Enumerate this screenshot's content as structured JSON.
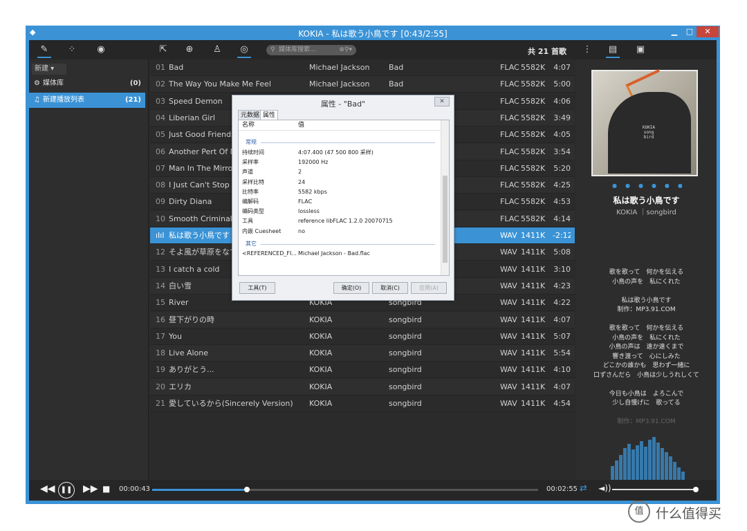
{
  "window": {
    "title": "KOKIA - 私は歌う小鳥です [0:43/2:55]",
    "minimize": "▁",
    "maximize": "□",
    "close": "✕"
  },
  "search": {
    "placeholder": "媒体库搜索..."
  },
  "count_label": "共 21 首歌",
  "sidebar": {
    "new_label": "新建 ▾",
    "items": [
      {
        "icon": "gear-icon",
        "label": "媒体库",
        "count": "(0)"
      },
      {
        "icon": "music-note-icon",
        "label": "新建播放列表",
        "count": "(21)"
      }
    ]
  },
  "tracks": [
    {
      "n": "01",
      "title": "Bad",
      "artist": "Michael Jackson",
      "album": "Bad",
      "fmt": "FLAC",
      "bitrate": "5582K",
      "dur": "4:07"
    },
    {
      "n": "02",
      "title": "The Way You Make Me Feel",
      "artist": "Michael Jackson",
      "album": "Bad",
      "fmt": "FLAC",
      "bitrate": "5582K",
      "dur": "5:00"
    },
    {
      "n": "03",
      "title": "Speed Demon",
      "artist": "",
      "album": "",
      "fmt": "FLAC",
      "bitrate": "5582K",
      "dur": "4:06"
    },
    {
      "n": "04",
      "title": "Liberian Girl",
      "artist": "",
      "album": "",
      "fmt": "FLAC",
      "bitrate": "5582K",
      "dur": "3:49"
    },
    {
      "n": "05",
      "title": "Just Good Friends",
      "artist": "",
      "album": "",
      "fmt": "FLAC",
      "bitrate": "5582K",
      "dur": "4:05"
    },
    {
      "n": "06",
      "title": "Another Pert Of Me",
      "artist": "",
      "album": "",
      "fmt": "FLAC",
      "bitrate": "5582K",
      "dur": "3:54"
    },
    {
      "n": "07",
      "title": "Man In The Mirror",
      "artist": "",
      "album": "",
      "fmt": "FLAC",
      "bitrate": "5582K",
      "dur": "5:20"
    },
    {
      "n": "08",
      "title": "I Just Can't Stop Lo",
      "artist": "",
      "album": "",
      "fmt": "FLAC",
      "bitrate": "5582K",
      "dur": "4:25"
    },
    {
      "n": "09",
      "title": "Dirty Diana",
      "artist": "",
      "album": "",
      "fmt": "FLAC",
      "bitrate": "5582K",
      "dur": "4:53"
    },
    {
      "n": "10",
      "title": "Smooth Criminal",
      "artist": "",
      "album": "",
      "fmt": "FLAC",
      "bitrate": "5582K",
      "dur": "4:14"
    },
    {
      "n": "ıIıl",
      "title": "私は歌う小鳥です",
      "artist": "",
      "album": "",
      "fmt": "WAV",
      "bitrate": "1411K",
      "dur": "-2:12"
    },
    {
      "n": "12",
      "title": "そよ風が草原をなで",
      "artist": "",
      "album": "",
      "fmt": "WAV",
      "bitrate": "1411K",
      "dur": "5:08"
    },
    {
      "n": "13",
      "title": "I catch a cold",
      "artist": "",
      "album": "",
      "fmt": "WAV",
      "bitrate": "1411K",
      "dur": "3:10"
    },
    {
      "n": "14",
      "title": "白い雪",
      "artist": "",
      "album": "",
      "fmt": "WAV",
      "bitrate": "1411K",
      "dur": "4:23"
    },
    {
      "n": "15",
      "title": "River",
      "artist": "KOKIA",
      "album": "songbird",
      "fmt": "WAV",
      "bitrate": "1411K",
      "dur": "4:22"
    },
    {
      "n": "16",
      "title": "昼下がりの時",
      "artist": "KOKIA",
      "album": "songbird",
      "fmt": "WAV",
      "bitrate": "1411K",
      "dur": "4:07"
    },
    {
      "n": "17",
      "title": "You",
      "artist": "KOKIA",
      "album": "songbird",
      "fmt": "WAV",
      "bitrate": "1411K",
      "dur": "5:07"
    },
    {
      "n": "18",
      "title": "Live Alone",
      "artist": "KOKIA",
      "album": "songbird",
      "fmt": "WAV",
      "bitrate": "1411K",
      "dur": "5:54"
    },
    {
      "n": "19",
      "title": "ありがとう...",
      "artist": "KOKIA",
      "album": "songbird",
      "fmt": "WAV",
      "bitrate": "1411K",
      "dur": "4:10"
    },
    {
      "n": "20",
      "title": "エリカ",
      "artist": "KOKIA",
      "album": "songbird",
      "fmt": "WAV",
      "bitrate": "1411K",
      "dur": "4:07"
    },
    {
      "n": "21",
      "title": "愛しているから(Sincerely Version)",
      "artist": "KOKIA",
      "album": "songbird",
      "fmt": "WAV",
      "bitrate": "1411K",
      "dur": "4:54"
    }
  ],
  "now_playing": {
    "cover_text": "KOKIA\nsong\nbird",
    "title": "私は歌う小鳥です",
    "subtitle": "KOKIA ｜songbird",
    "lyrics": [
      "歌を歌って　何かを伝える",
      "小鳥の声を　私にくれた",
      "",
      "私は歌う小鳥です",
      "制作：MP3.91.COM",
      "",
      "歌を歌って　何かを伝える",
      "小鳥の声を　私にくれた",
      "小鳥の声は　遠か遠くまで",
      "響き渡って　心にしみた",
      "どこかの誰かも　思わず一緒に",
      "口ずさんだら　小鳥は少しうれしくて",
      "",
      "今日も小鳥は　よろこんで",
      "少し自慢げに　歌ってる",
      "",
      "制作：MP3.91.COM"
    ]
  },
  "player": {
    "elapsed": "00:00:43",
    "total": "00:02:55",
    "progress": 0.246,
    "volume": 1.0
  },
  "dialog": {
    "title": "属性 - \"Bad\"",
    "close": "✕",
    "tabs": [
      "元数据",
      "属性"
    ],
    "col_name": "名称",
    "col_value": "值",
    "group_general": "常规",
    "group_other": "其它",
    "rows": [
      {
        "k": "持续时间",
        "v": "4:07.400 (47 500 800 采样)"
      },
      {
        "k": "采样率",
        "v": "192000 Hz"
      },
      {
        "k": "声道",
        "v": "2"
      },
      {
        "k": "采样比特",
        "v": "24"
      },
      {
        "k": "比特率",
        "v": "5582 kbps"
      },
      {
        "k": "编解码",
        "v": "FLAC"
      },
      {
        "k": "编码类型",
        "v": "lossless"
      },
      {
        "k": "工具",
        "v": "reference libFLAC 1.2.0 20070715"
      },
      {
        "k": "内嵌 Cuesheet",
        "v": "no"
      }
    ],
    "other_rows": [
      {
        "k": "<REFERENCED_FI...",
        "v": "Michael Jackson - Bad.flac"
      }
    ],
    "btn_tools": "工具(T)",
    "btn_ok": "确定(O)",
    "btn_cancel": "取消(C)",
    "btn_apply": "应用(A)"
  },
  "watermark": {
    "text": "什么值得买",
    "icon": "值"
  },
  "colors": {
    "accent": "#3b93d6",
    "titlebar": "#3b93d6",
    "close": "#c7463b",
    "background": "#2b2b2b"
  }
}
